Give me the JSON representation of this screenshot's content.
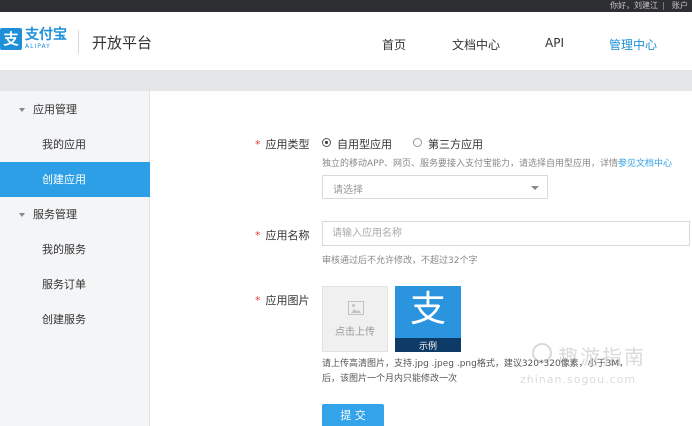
{
  "topbar": {
    "greeting": "你好，刘建江",
    "account": "账户"
  },
  "header": {
    "logo_mark": "支",
    "logo_cn": "支付宝",
    "logo_en": "ALIPAY",
    "platform_name": "开放平台",
    "nav": [
      {
        "label": "首页",
        "active": false
      },
      {
        "label": "文档中心",
        "active": false
      },
      {
        "label": "API",
        "active": false
      },
      {
        "label": "管理中心",
        "active": true
      }
    ]
  },
  "sidebar": {
    "groups": [
      {
        "label": "应用管理",
        "items": [
          {
            "label": "我的应用",
            "active": false
          },
          {
            "label": "创建应用",
            "active": true
          }
        ]
      },
      {
        "label": "服务管理",
        "items": [
          {
            "label": "我的服务",
            "active": false
          },
          {
            "label": "服务订单",
            "active": false
          },
          {
            "label": "创建服务",
            "active": false
          }
        ]
      }
    ]
  },
  "form": {
    "app_type": {
      "label": "应用类型",
      "options": [
        {
          "label": "自用型应用",
          "checked": true
        },
        {
          "label": "第三方应用",
          "checked": false
        }
      ],
      "hint": "独立的移动APP、网页、服务要接入支付宝能力，请选择自用型应用，详情",
      "hint_link": "参见文档中心",
      "select_placeholder": "请选择"
    },
    "app_name": {
      "label": "应用名称",
      "placeholder": "请输入应用名称",
      "value": "",
      "hint": "审核通过后不允许修改，不超过32个字"
    },
    "app_image": {
      "label": "应用图片",
      "upload_text": "点击上传",
      "sample_glyph": "支",
      "sample_caption": "示例",
      "desc_line1": "请上传高清图片，支持.jpg .jpeg .png格式，建议320*320像素，小于3M，",
      "desc_line2": "后，该图片一个月内只能修改一次"
    },
    "submit_label": "提 交"
  },
  "watermark": {
    "cn": "趣游指南",
    "en": "zhinan.sogou.com"
  },
  "colors": {
    "accent": "#2c9fe6",
    "brand": "#1e8fd9",
    "required": "#e3383b",
    "topbar": "#2e2f33"
  },
  "icons": {
    "upload": "image-icon",
    "caret": "caret-down-icon",
    "select": "chevron-down-icon"
  }
}
